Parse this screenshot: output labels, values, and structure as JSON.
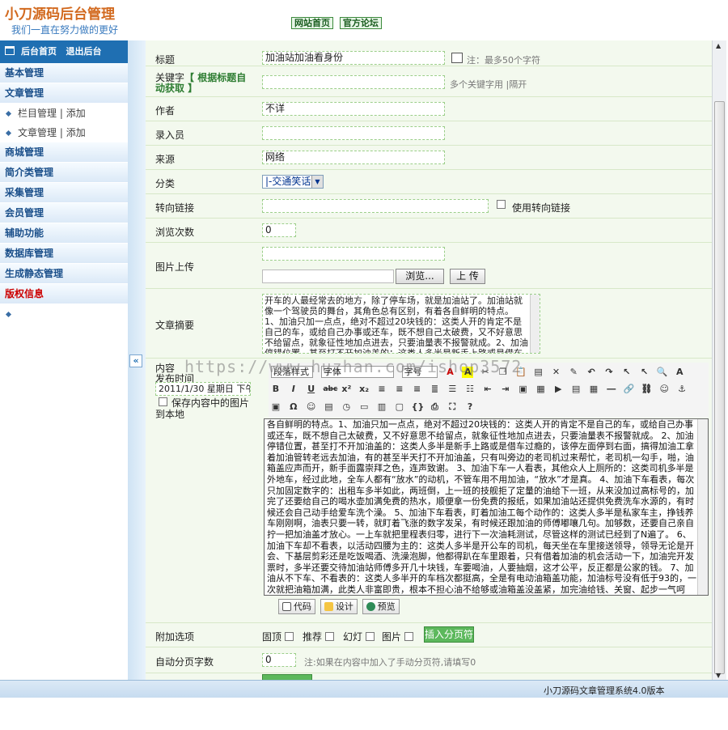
{
  "header": {
    "logo_part1": "小刀源码",
    "logo_part2": "后台管理",
    "slogan": "我们一直在努力做的更好",
    "links": [
      "网站首页",
      "官方论坛"
    ]
  },
  "sidebar": {
    "top_links": [
      "后台首页",
      "退出后台"
    ],
    "categories": [
      {
        "label": "基本管理"
      },
      {
        "label": "文章管理",
        "subitems": [
          {
            "name": "栏目管理",
            "action": "添加"
          },
          {
            "name": "文章管理",
            "action": "添加"
          }
        ]
      },
      {
        "label": "商城管理"
      },
      {
        "label": "简介类管理"
      },
      {
        "label": "采集管理"
      },
      {
        "label": "会员管理"
      },
      {
        "label": "辅助功能"
      },
      {
        "label": "数据库管理"
      },
      {
        "label": "生成静态管理"
      },
      {
        "label": "版权信息",
        "highlight": true
      }
    ],
    "collapse_label": "«"
  },
  "form": {
    "title": {
      "label": "标题",
      "value": "加油站加油看身份",
      "note": "注：最多50个字符"
    },
    "keywords": {
      "label": "关键字",
      "auto_label": "【 根据标题自动获取 】",
      "value": "",
      "note": "多个关键字用 |隔开"
    },
    "author": {
      "label": "作者",
      "value": "不详"
    },
    "editor_user": {
      "label": "录入员",
      "value": ""
    },
    "source": {
      "label": "来源",
      "value": "网络"
    },
    "category": {
      "label": "分类",
      "value": "|-交通笑话"
    },
    "redirect": {
      "label": "转向链接",
      "value": "",
      "checkbox_label": "使用转向链接"
    },
    "views": {
      "label": "浏览次数",
      "value": "0"
    },
    "image": {
      "label": "图片上传",
      "value": "",
      "browse_label": "浏览...",
      "upload_label": "上 传"
    },
    "summary": {
      "label": "文章摘要",
      "text": "开车的人最经常去的地方，除了停车场，就是加油站了。加油站就像一个驾驶员的舞台，其角色总有区别，有着各自鲜明的特点。 1、加油只加一点点，绝对不超过20块钱的：这类人开的肯定不是自己的车，或给自己办事或还车，既不想自己太破费，又不好意思不给留点，就象征性地加点进去，只要油量表不报警就成。2、加油停错位置，甚至打不开加油盖的：这类人多半是新手上路或是借车过瘾的，"
    },
    "content": {
      "label": "内容",
      "pubtime_label": "发布时间",
      "pubtime_value": "2011/1/30 星期日 下午",
      "save_images_label": "保存内容中的图片到本地",
      "toolbar": {
        "para_format": "段落样式",
        "font": "字体",
        "size": "字号"
      },
      "text": "各自鲜明的特点。1、加油只加一点点，绝对不超过20块钱的：这类人开的肯定不是自己的车，或给自己办事或还车，既不想自己太破费，又不好意思不给留点，就象征性地加点进去，只要油量表不报警就成。 2、加油停错位置，甚至打不开加油盖的：这类人多半是新手上路或是借车过瘾的，该停左面停到右面，搞得加油工拿着加油管转老远去加油，有的甚至半天打不开加油盖，只有叫旁边的老司机过来帮忙，老司机一勾手，啪，油箱盖应声而开，新手面露崇拜之色，连声致谢。 3、加油下车一人看表，其他众人上厕所的：这类司机多半是外地车，经过此地，全车人都有“放水”的动机，不管车用不用加油，“放水”才是真。 4、加油下车看表，每次只加固定数字的：出租车多半如此，两班倒，上一班的技舰拒了定量的油给下一班，从来没加过高标号的，加完了还要给自己的喝水壶加满免费的热水，顺便拿一份免费的报纸，如果加油站还提供免费洗车水源的，有时候还会自己动手给爱车洗个澡。 5、加油下车看表，盯着加油工每个动作的：这类人多半是私家车主，挣钱养车刚刚啊，油表只要一转，就盯着飞涨的数字发呆，有时候还跟加油的师傅嘟嚷几句。加够数，还要自己亲自拧一把加油盖才放心。一上车就把里程表归零，进行下一次油耗测试，尽管这样的测试已经到了N遍了。 6、加油下车却不看表，以活动四腰为主的：这类人多半是开公车的司机，每天坐在车里接送领导，领导无论是开会、下基层剪彩还是吃饭喝酒、洗澡泡脚，他都得趴在车里跟着，只有借着加油的机会活动一下，加油完开发票时，多半还要交待加油站师傅多开几十块钱，车要喝油，人要抽烟，这才公平，反正都是公家的钱。 7、加油从不下车、不看表的：这类人多半开的车档次都挺高，全是有电动油箱盖功能，加油标号没有低于93的，一次就把油箱加满，此类人非富即贵，根本不担心油不给够或油箱盖没盖紧，加完油给钱、关窗、起步一气呵成，也是加油站师傅最欢迎的客人。",
      "tabs": [
        "代码",
        "设计",
        "预览"
      ]
    },
    "extra": {
      "label": "附加选项",
      "options": [
        "固顶",
        "推荐",
        "幻灯",
        "图片"
      ],
      "insert_page_label": "插入分页符"
    },
    "autopage": {
      "label": "自动分页字数",
      "value": "0",
      "note": "注:如果在内容中加入了手动分页符,请填写0"
    }
  },
  "watermark": "https://www.huzhan.com/ishop3572",
  "footer": {
    "text": "小刀源码文章管理系统4.0版本"
  }
}
